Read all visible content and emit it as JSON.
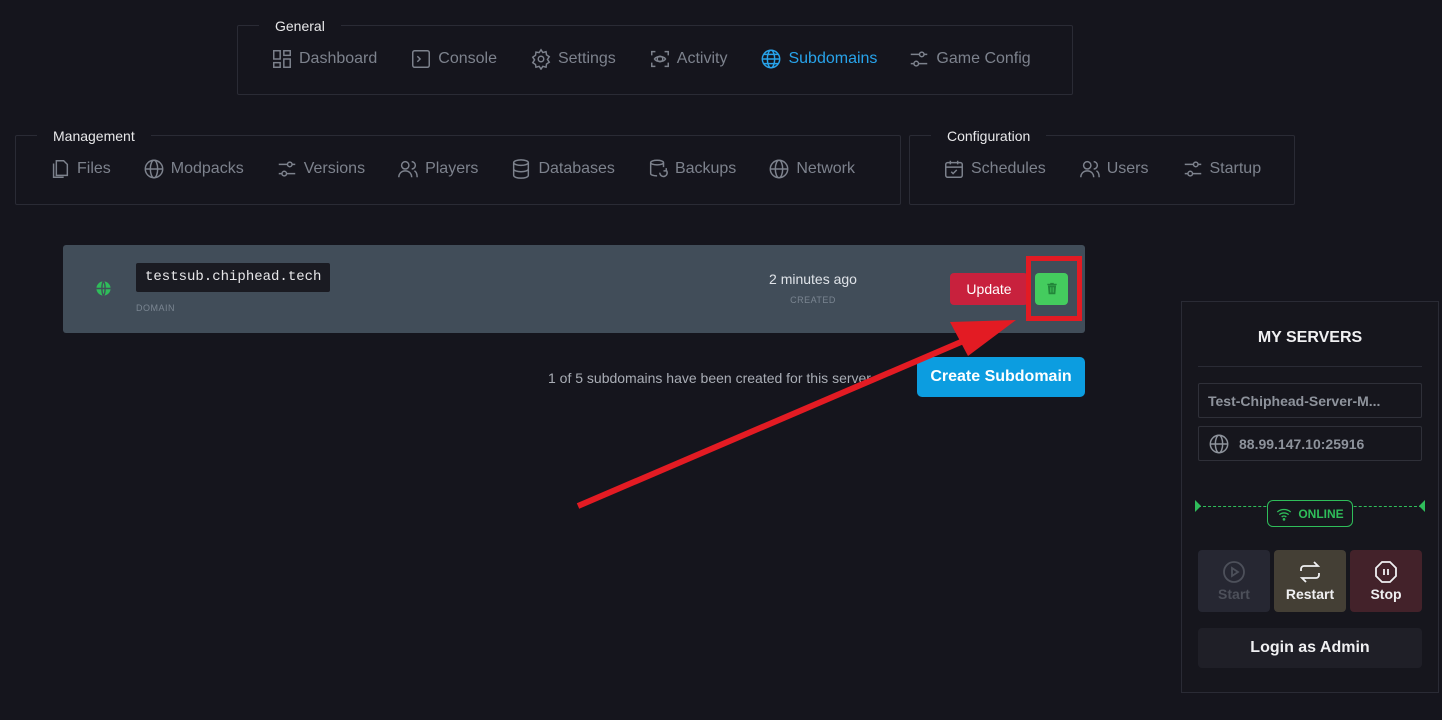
{
  "nav": {
    "general": {
      "label": "General",
      "items": [
        {
          "label": "Dashboard",
          "icon": "dashboard-icon"
        },
        {
          "label": "Console",
          "icon": "console-icon"
        },
        {
          "label": "Settings",
          "icon": "gear-icon"
        },
        {
          "label": "Activity",
          "icon": "activity-icon"
        },
        {
          "label": "Subdomains",
          "icon": "globe-icon",
          "active": true
        },
        {
          "label": "Game Config",
          "icon": "sliders-icon"
        }
      ]
    },
    "management": {
      "label": "Management",
      "items": [
        {
          "label": "Files",
          "icon": "files-icon"
        },
        {
          "label": "Modpacks",
          "icon": "globe-icon"
        },
        {
          "label": "Versions",
          "icon": "sliders-icon"
        },
        {
          "label": "Players",
          "icon": "users-icon"
        },
        {
          "label": "Databases",
          "icon": "database-icon"
        },
        {
          "label": "Backups",
          "icon": "backup-icon"
        },
        {
          "label": "Network",
          "icon": "globe-icon"
        }
      ]
    },
    "configuration": {
      "label": "Configuration",
      "items": [
        {
          "label": "Schedules",
          "icon": "calendar-icon"
        },
        {
          "label": "Users",
          "icon": "users-icon"
        },
        {
          "label": "Startup",
          "icon": "sliders-icon"
        }
      ]
    }
  },
  "subdomain": {
    "name": "testsub.chiphead.tech",
    "domain_caption": "DOMAIN",
    "created": "2 minutes ago",
    "created_caption": "CREATED",
    "update_label": "Update"
  },
  "limit_text": "1 of 5 subdomains have been created for this server.",
  "create_label": "Create Subdomain",
  "servers": {
    "title": "MY SERVERS",
    "server_name": "Test-Chiphead-Server-M...",
    "address": "88.99.147.10:25916",
    "status": "ONLINE",
    "start_label": "Start",
    "restart_label": "Restart",
    "stop_label": "Stop",
    "admin_label": "Login as Admin"
  },
  "colors": {
    "accent": "#28a3ea",
    "update": "#c8213d",
    "delete": "#44cc5e",
    "create": "#0c9de0",
    "online": "#2fbd5a",
    "annotation": "#e31b23"
  }
}
